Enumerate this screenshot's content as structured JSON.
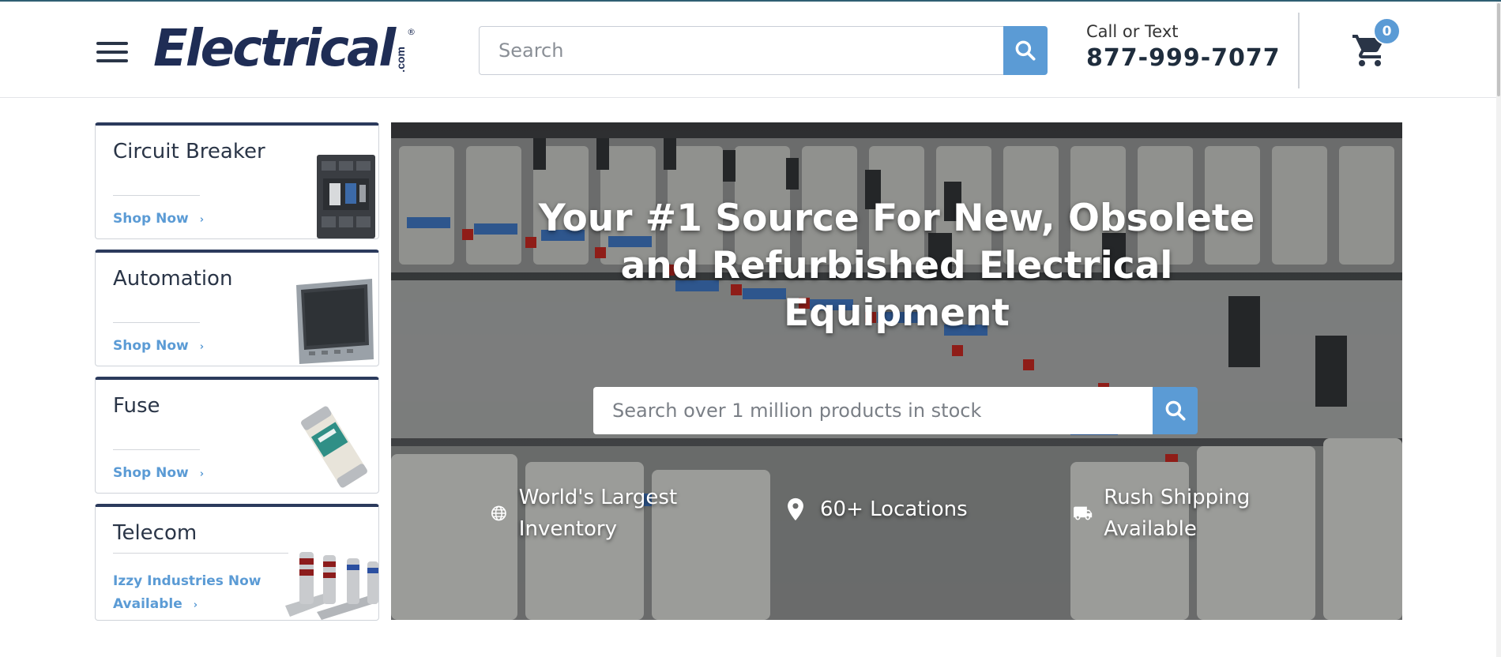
{
  "header": {
    "logo_text": "Electrical",
    "logo_suffix": ".com",
    "logo_reg": "®",
    "search_placeholder": "Search",
    "contact_label": "Call or Text",
    "contact_phone": "877-999-7077",
    "cart_count": "0"
  },
  "categories": [
    {
      "title": "Circuit Breaker",
      "link": "Shop Now",
      "chevron": "›"
    },
    {
      "title": "Automation",
      "link": "Shop Now",
      "chevron": "›"
    },
    {
      "title": "Fuse",
      "link": "Shop Now",
      "chevron": "›"
    },
    {
      "title": "Telecom",
      "link": "Izzy Industries Now Available",
      "chevron": "›"
    }
  ],
  "hero": {
    "headline": "Your #1 Source For New, Obsolete and Refurbished Electrical Equipment",
    "search_placeholder": "Search over 1 million products in stock",
    "features": [
      {
        "text": "World's Largest Inventory",
        "icon": "globe-icon"
      },
      {
        "text": "60+ Locations",
        "icon": "location-pin-icon"
      },
      {
        "text": "Rush Shipping Available",
        "icon": "truck-icon"
      }
    ]
  },
  "colors": {
    "accent": "#5b9bd5",
    "navy": "#2b3a5c",
    "logo": "#1f2d55"
  }
}
